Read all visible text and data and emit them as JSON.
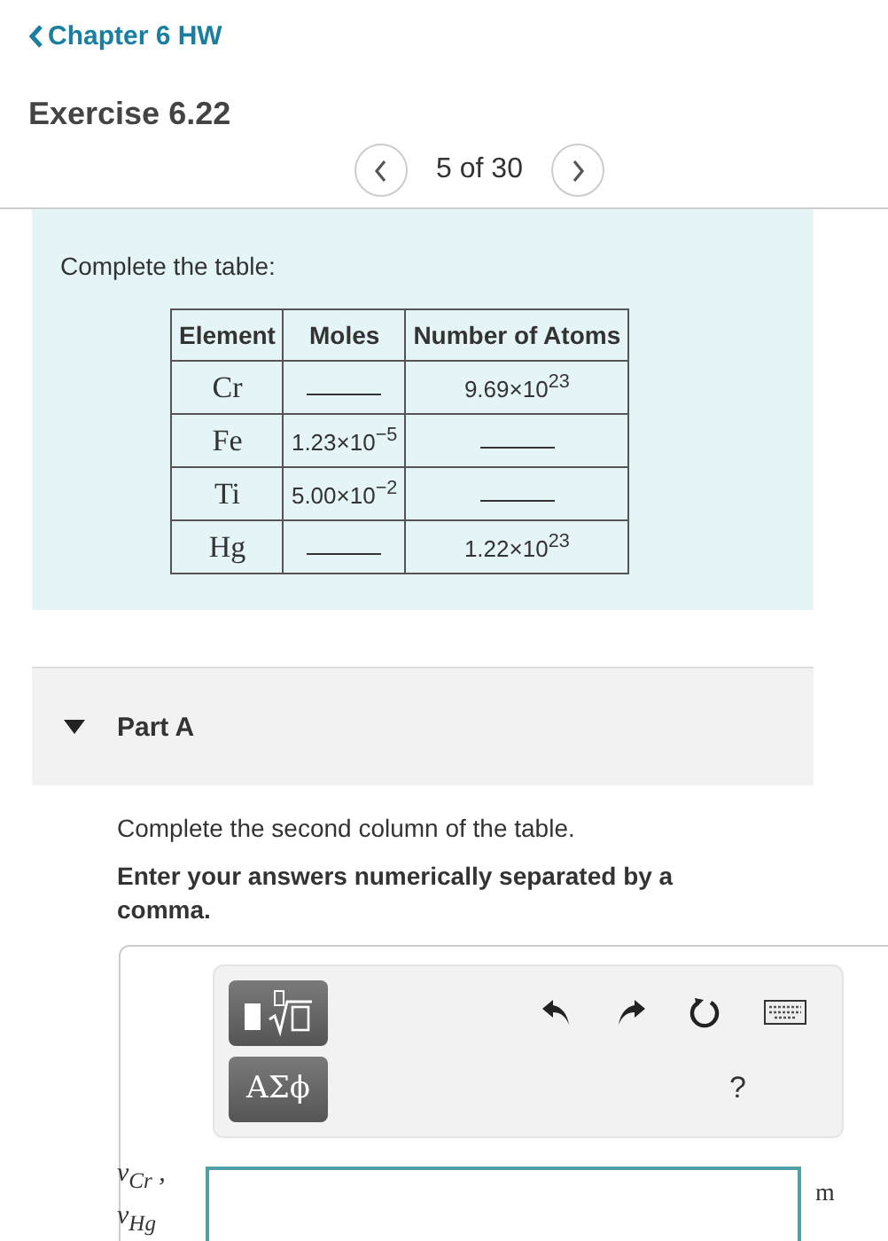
{
  "back_link": "Chapter 6 HW",
  "exercise_title": "Exercise 6.22",
  "pager": {
    "position": "5 of 30"
  },
  "problem": {
    "instruction": "Complete the table:",
    "table": {
      "columns": [
        "Element",
        "Moles",
        "Number of Atoms"
      ],
      "rows": [
        [
          {
            "kind": "symbol",
            "text": "Cr"
          },
          {
            "kind": "blank"
          },
          {
            "kind": "value",
            "text": "9.69×10$^{23}$"
          }
        ],
        [
          {
            "kind": "symbol",
            "text": "Fe"
          },
          {
            "kind": "value",
            "text": "1.23×10$^{−5}$"
          },
          {
            "kind": "blank"
          }
        ],
        [
          {
            "kind": "symbol",
            "text": "Ti"
          },
          {
            "kind": "value",
            "text": "5.00×10$^{−2}$"
          },
          {
            "kind": "blank"
          }
        ],
        [
          {
            "kind": "symbol",
            "text": "Hg"
          },
          {
            "kind": "blank"
          },
          {
            "kind": "value",
            "text": "1.22×10$^{23}$"
          }
        ]
      ]
    }
  },
  "part": {
    "title": "Part A",
    "expanded": true,
    "prompt": "Complete the second column of the table.",
    "directive": "Enter your answers numerically separated by a comma.",
    "answer": {
      "greek_button": "ΑΣϕ",
      "help": "?",
      "variables": [
        "ν$_{Cr}$ ,",
        "ν$_{Hg}$"
      ],
      "unit": "m"
    }
  }
}
